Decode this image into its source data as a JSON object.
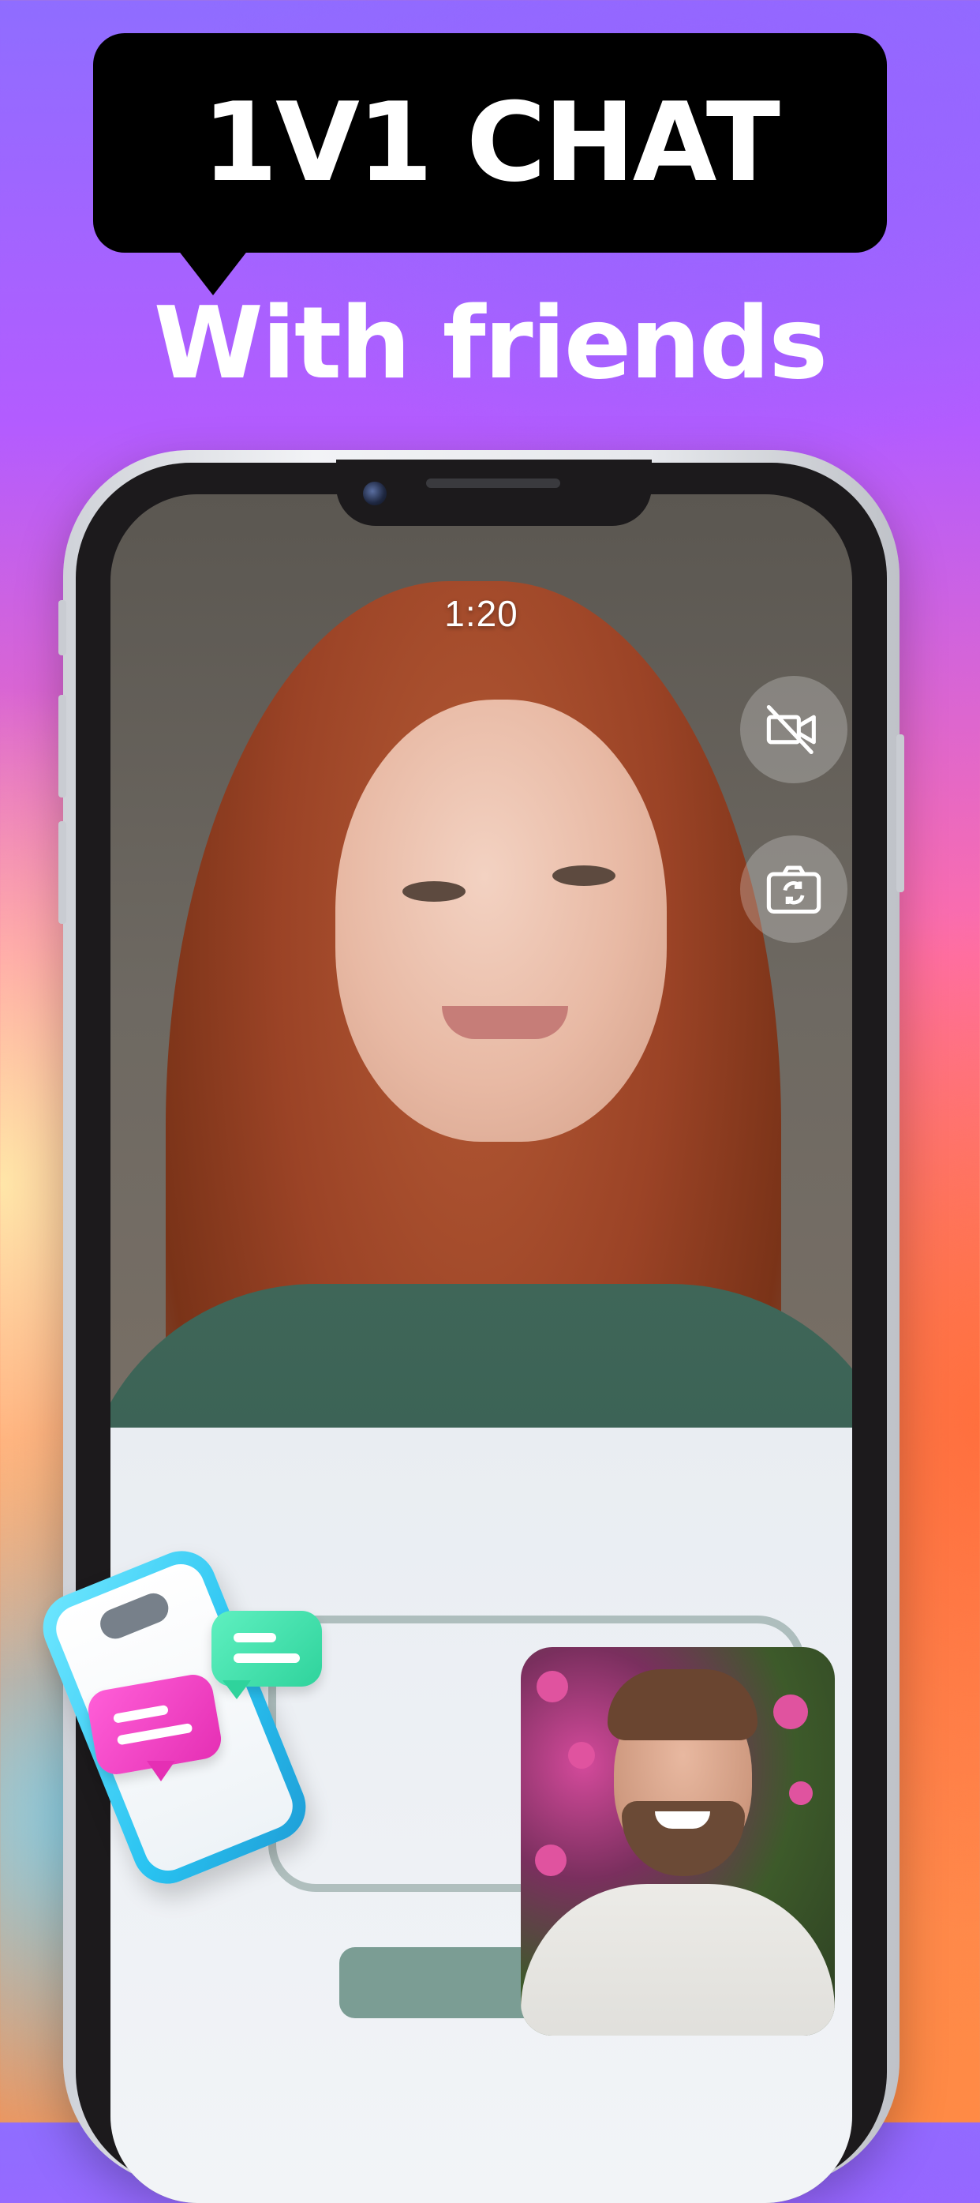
{
  "header": {
    "headline": "1V1 CHAT",
    "subheadline": "With friends"
  },
  "call": {
    "timer": "1:20",
    "controls": [
      {
        "icon": "video-off-icon"
      },
      {
        "icon": "switch-camera-icon"
      }
    ]
  },
  "colors": {
    "bubble_bg": "#000000",
    "chat_bubble_pink": "#f03fc1",
    "chat_bubble_green": "#37e0a8",
    "icon_phone_blue": "#29c3f1"
  }
}
